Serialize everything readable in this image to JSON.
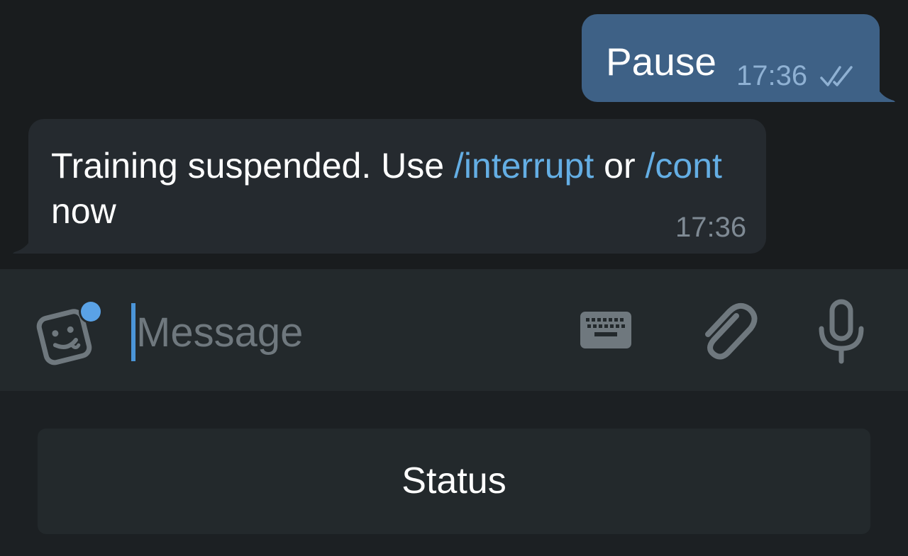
{
  "messages": {
    "outgoing": {
      "text": "Pause",
      "time": "17:36",
      "status_icon": "double-check-icon"
    },
    "incoming": {
      "text_part1": "Training suspended. Use ",
      "cmd_interrupt": "/interrupt",
      "text_part2": " or ",
      "cmd_cont": "/cont",
      "text_part3": " now",
      "time": "17:36"
    }
  },
  "composer": {
    "placeholder": "Message",
    "value": "",
    "icons": [
      "sticker-icon",
      "keyboard-icon",
      "paperclip-icon",
      "microphone-icon"
    ]
  },
  "reply_keyboard": {
    "buttons": [
      {
        "label": "Status"
      }
    ]
  },
  "colors": {
    "background": "#191c1e",
    "outgoing_bubble": "#3e6186",
    "incoming_bubble": "#252a2f",
    "link": "#64aee4",
    "cursor": "#4b95d8",
    "composer": "#23292c"
  }
}
